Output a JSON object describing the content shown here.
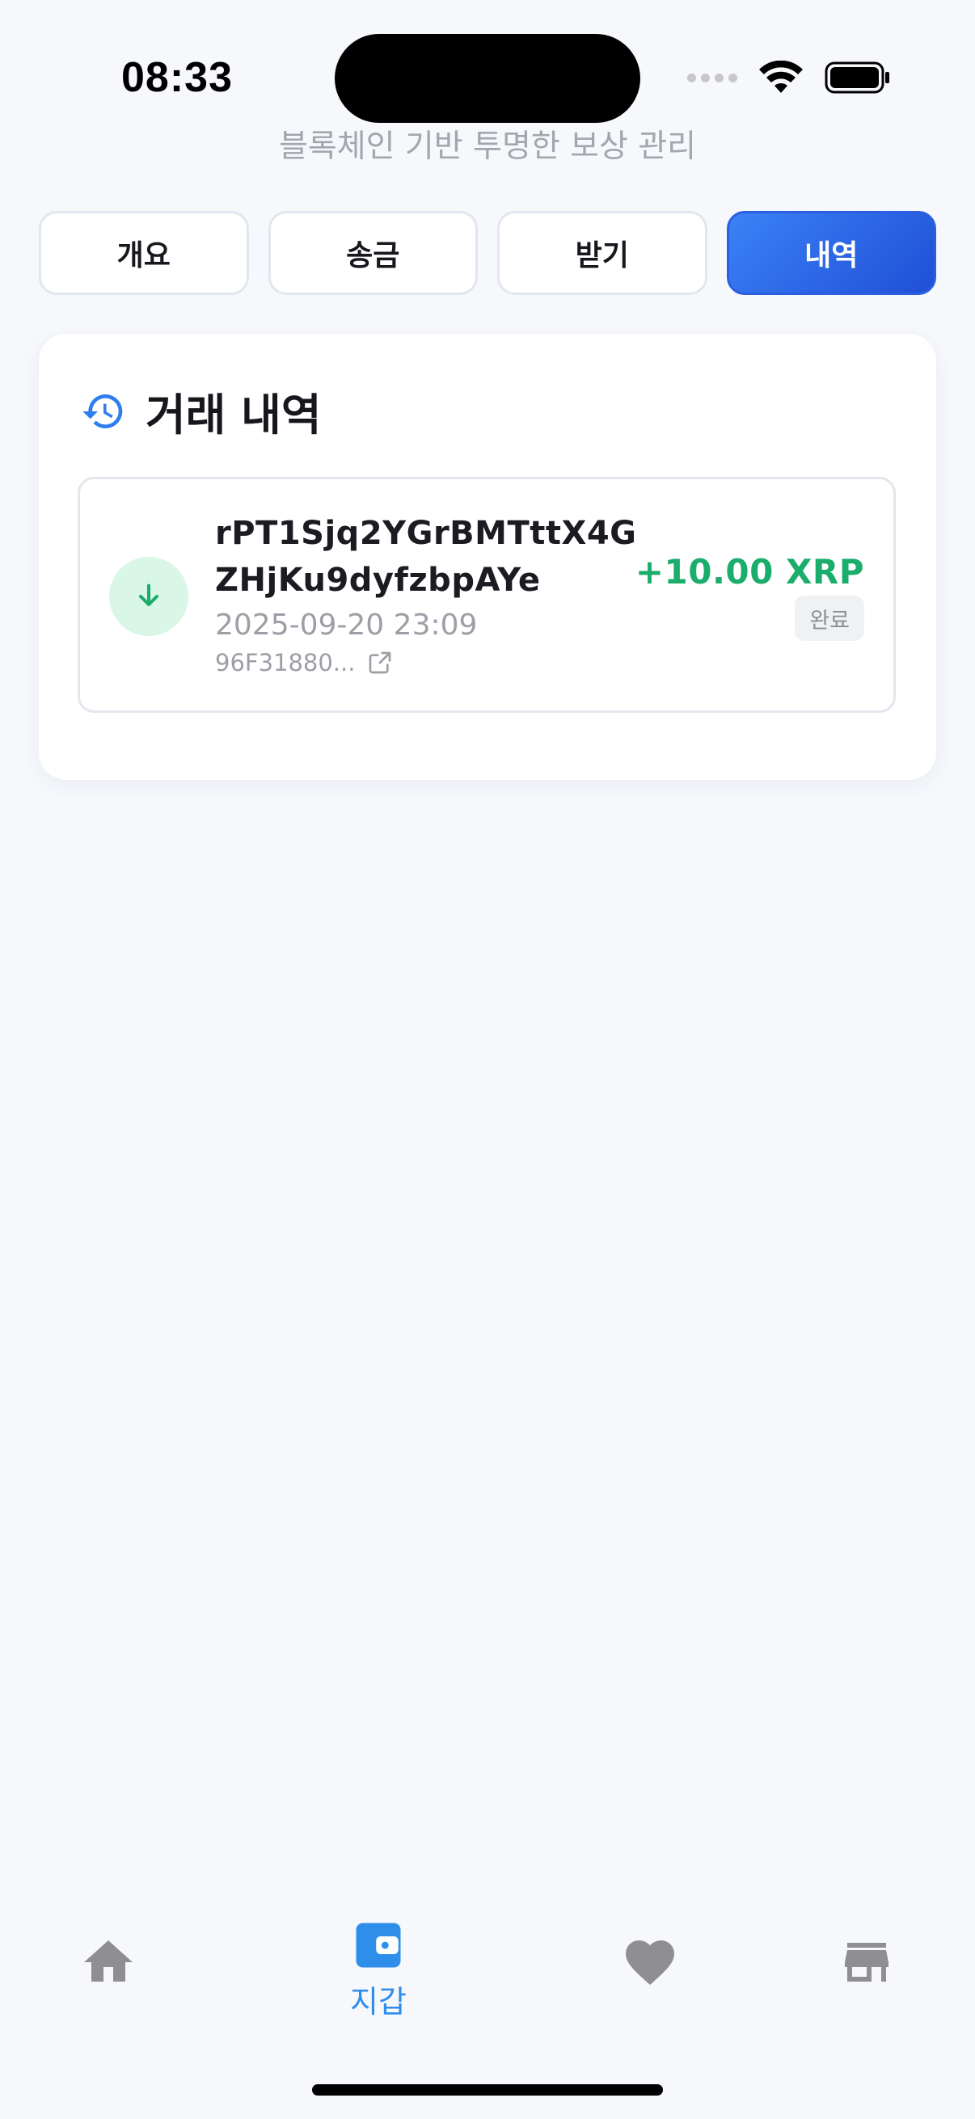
{
  "status_bar": {
    "time": "08:33"
  },
  "subtitle": "블록체인 기반 투명한 보상 관리",
  "tabs": [
    {
      "label": "개요",
      "active": false
    },
    {
      "label": "송금",
      "active": false
    },
    {
      "label": "받기",
      "active": false
    },
    {
      "label": "내역",
      "active": true
    }
  ],
  "history": {
    "title": "거래 내역",
    "transactions": [
      {
        "address": "rPT1Sjq2YGrBMTttX4GZHjKu9dyfzbpAYe",
        "date": "2025-09-20 23:09",
        "hash": "96F31880...",
        "amount": "+10.00 XRP",
        "status": "완료",
        "direction": "incoming"
      }
    ]
  },
  "bottom_nav": {
    "items": [
      {
        "icon": "home-icon",
        "label": ""
      },
      {
        "icon": "wallet-icon",
        "label": "지갑",
        "active": true
      },
      {
        "icon": "heart-icon",
        "label": ""
      },
      {
        "icon": "store-icon",
        "label": ""
      }
    ]
  },
  "colors": {
    "accent": "#2f8eea",
    "tab_active_start": "#3c82f6",
    "tab_active_end": "#1f4fd6",
    "positive": "#1aad6c",
    "inactive_icon": "#8e8e93"
  }
}
